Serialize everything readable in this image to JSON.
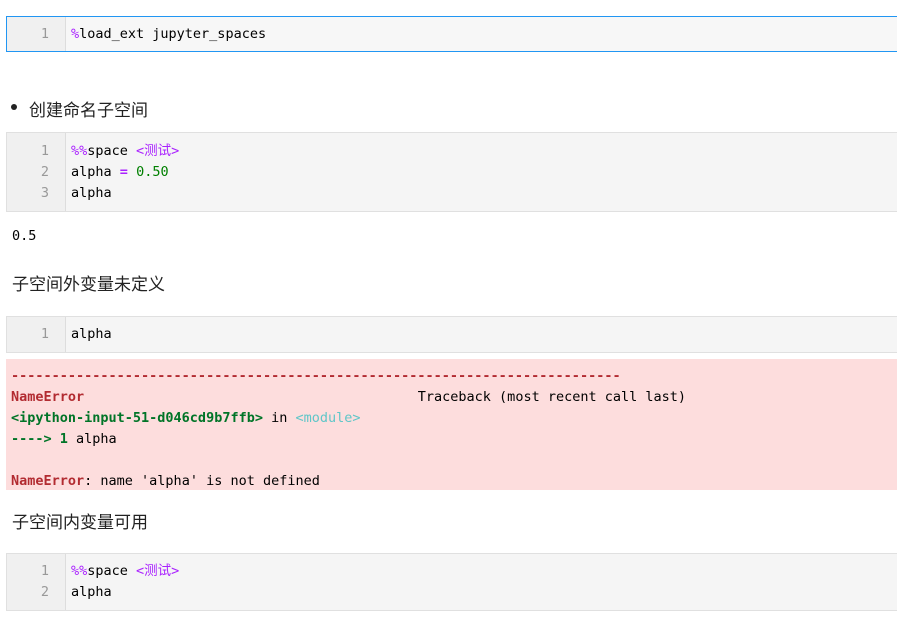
{
  "cells": [
    {
      "lines": [
        {
          "n": "1",
          "magic": "%",
          "rest": "load_ext jupyter_spaces"
        }
      ]
    },
    {
      "lines": [
        {
          "n": "1",
          "magic": "%%",
          "rest": "space ",
          "arg": "<测试>"
        },
        {
          "n": "2",
          "name": "alpha",
          "op": "=",
          "value": "0.50"
        },
        {
          "n": "3",
          "text": "alpha"
        }
      ]
    },
    {
      "lines": [
        {
          "n": "1",
          "text": "alpha"
        }
      ]
    },
    {
      "lines": [
        {
          "n": "1",
          "magic": "%%",
          "rest": "space ",
          "arg": "<测试>"
        },
        {
          "n": "2",
          "text": "alpha"
        }
      ]
    }
  ],
  "markdown": {
    "bullet": "创建命名子空间",
    "outside_heading": "子空间外变量未定义",
    "inside_heading": "子空间内变量可用"
  },
  "output_value": "0.5",
  "error": {
    "dashes": "---------------------------------------------------------------------------",
    "type": "NameError",
    "traceback_label": "Traceback (most recent call last)",
    "input_ref": "<ipython-input-51-d046cd9b7ffb>",
    "in_word": " in ",
    "module_ref": "<module>",
    "arrow": "---->",
    "arrow_line_no": "1",
    "arrow_code": " alpha",
    "message_type": "NameError",
    "message": ": name 'alpha' is not defined"
  },
  "colors": {
    "error_bg": "#fddddd",
    "error_red": "#b22b31",
    "error_green": "#007427",
    "magic_purple": "#aa22ff",
    "number_green": "#008000",
    "selected_border": "#2196f3"
  }
}
